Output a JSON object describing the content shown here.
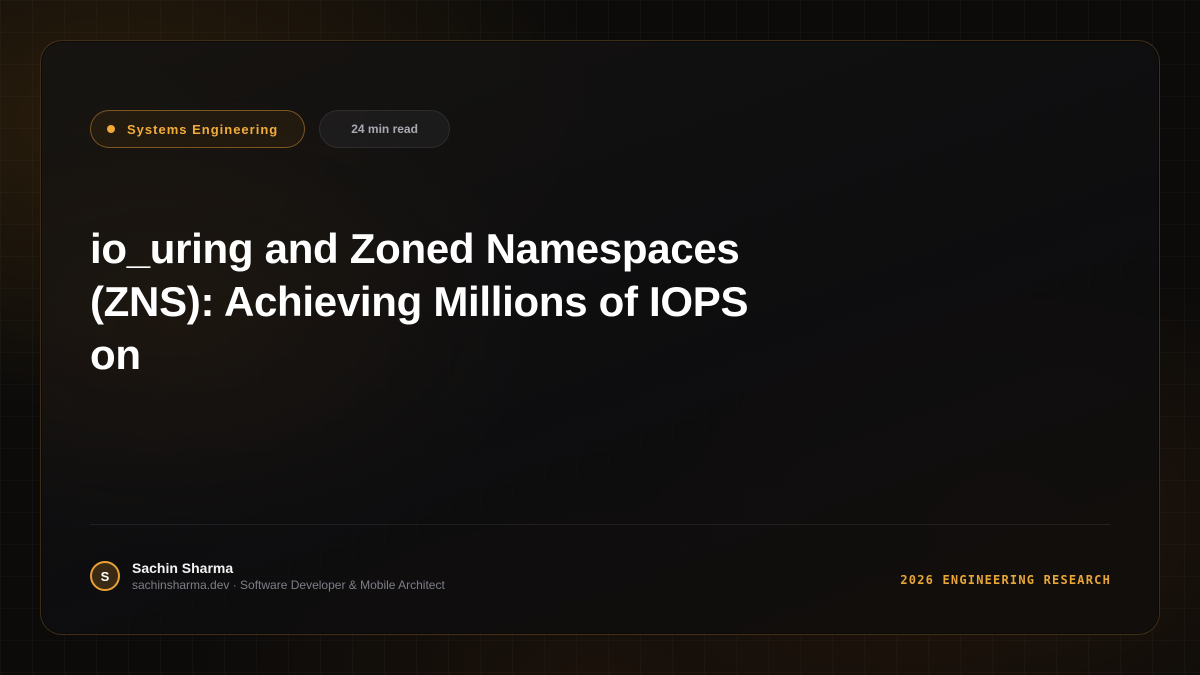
{
  "tags": {
    "category": "Systems Engineering",
    "read_time": "24 min read"
  },
  "article": {
    "title": "io_uring and Zoned Namespaces (ZNS): Achieving Millions of IOPS on"
  },
  "author": {
    "initial": "S",
    "name": "Sachin Sharma",
    "meta": "sachinsharma.dev · Software Developer & Mobile Architect"
  },
  "footer": {
    "label": "2026 ENGINEERING RESEARCH"
  },
  "colors": {
    "accent": "#f0a83a",
    "background": "#0c0b0a",
    "title": "#ffffff",
    "muted": "#7d7f88"
  }
}
